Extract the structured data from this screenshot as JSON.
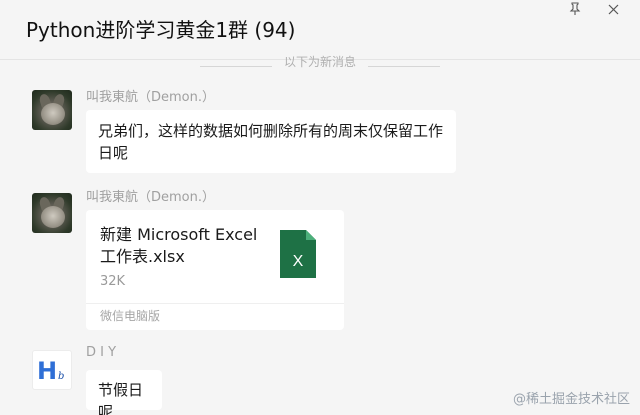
{
  "window": {
    "title": "Python进阶学习黄金1群 (94)",
    "pin_icon": "pin-icon",
    "close_icon": "close-icon"
  },
  "divider": {
    "text": "以下为新消息"
  },
  "messages": [
    {
      "sender": "叫我東航（Demon.）",
      "avatar": "cat-avatar",
      "text": "兄弟们，这样的数据如何删除所有的周末仅保留工作日呢"
    },
    {
      "sender": "叫我東航（Demon.）",
      "avatar": "cat-avatar",
      "file": {
        "name": "新建 Microsoft Excel 工作表.xlsx",
        "size": "32K",
        "source": "微信电脑版",
        "icon": "excel-file-icon",
        "icon_letter": "X",
        "icon_color": "#1e7145"
      }
    },
    {
      "sender": "D I Y",
      "avatar": "diy-avatar",
      "avatar_letter": "H",
      "avatar_sub": "b",
      "text": "节假日呢"
    }
  ],
  "watermark": "@稀土掘金技术社区"
}
